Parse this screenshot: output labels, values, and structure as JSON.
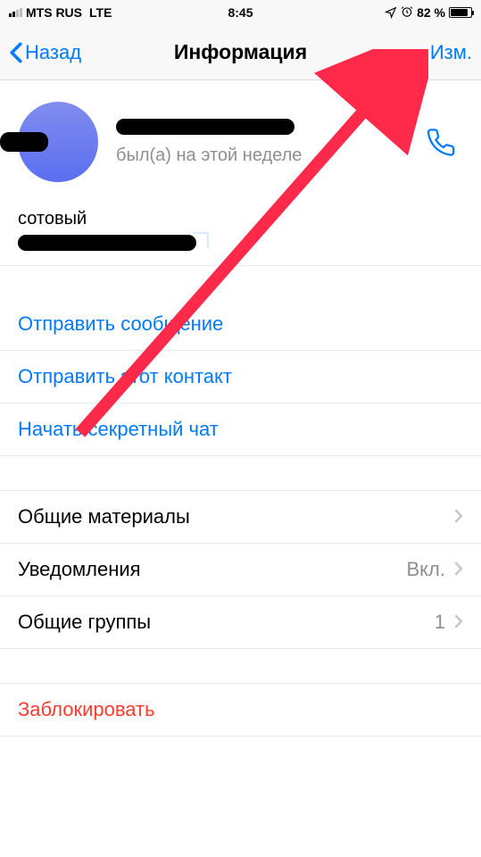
{
  "status": {
    "carrier": "MTS RUS",
    "network": "LTE",
    "time": "8:45",
    "battery_pct": "82 %"
  },
  "nav": {
    "back": "Назад",
    "title": "Информация",
    "edit": "Изм."
  },
  "profile": {
    "last_seen": "был(а) на этой неделе"
  },
  "phone": {
    "label": "сотовый"
  },
  "actions": {
    "send_message": "Отправить сообщение",
    "share_contact": "Отправить этот контакт",
    "secret_chat": "Начать секретный чат"
  },
  "settings": {
    "shared_media": {
      "label": "Общие материалы"
    },
    "notifications": {
      "label": "Уведомления",
      "value": "Вкл."
    },
    "common_groups": {
      "label": "Общие группы",
      "value": "1"
    }
  },
  "block": {
    "label": "Заблокировать"
  }
}
